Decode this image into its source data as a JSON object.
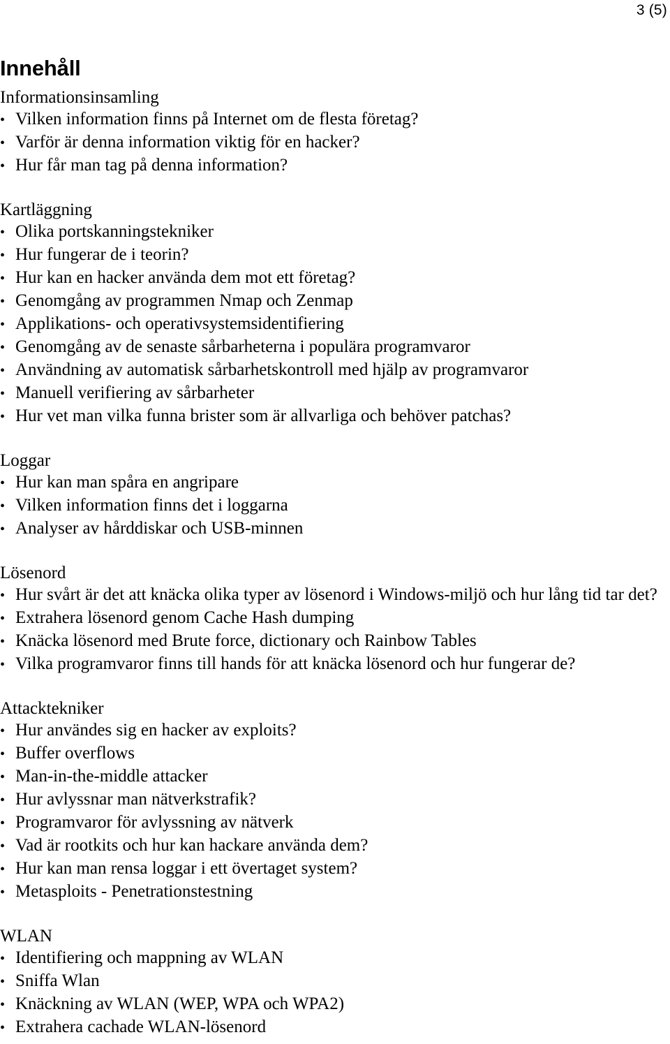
{
  "document": {
    "page_number": "3 (5)",
    "title": "Innehåll",
    "bullet_glyph": "•",
    "text_color": "#000000",
    "background_color": "#ffffff"
  },
  "sections": [
    {
      "heading": "Informationsinsamling",
      "items": [
        "Vilken information finns på Internet om de flesta företag?",
        "Varför är denna information viktig för en hacker?",
        "Hur får man tag på denna information?"
      ]
    },
    {
      "heading": "Kartläggning",
      "items": [
        "Olika portskanningstekniker",
        "Hur fungerar de i teorin?",
        "Hur kan en hacker använda dem mot ett företag?",
        "Genomgång av programmen Nmap och Zenmap",
        "Applikations- och operativsystemsidentifiering",
        "Genomgång av de senaste sårbarheterna i populära programvaror",
        "Användning av automatisk sårbarhetskontroll med hjälp av programvaror",
        "Manuell verifiering av sårbarheter",
        "Hur vet man vilka funna brister som är allvarliga och behöver patchas?"
      ]
    },
    {
      "heading": "Loggar",
      "items": [
        "Hur kan man spåra en angripare",
        "Vilken information finns det i loggarna",
        "Analyser av hårddiskar och USB-minnen"
      ]
    },
    {
      "heading": "Lösenord",
      "items": [
        "Hur svårt är det att knäcka olika typer av lösenord i Windows-miljö och hur lång tid tar det?",
        "Extrahera lösenord genom Cache Hash dumping",
        "Knäcka lösenord med Brute force, dictionary och Rainbow Tables",
        "Vilka programvaror finns till hands för att knäcka lösenord och hur fungerar de?"
      ]
    },
    {
      "heading": "Attacktekniker",
      "items": [
        "Hur användes sig en hacker av exploits?",
        "Buffer overflows",
        "Man-in-the-middle attacker",
        "Hur avlyssnar man nätverkstrafik?",
        "Programvaror för avlyssning av nätverk",
        "Vad är rootkits och hur kan hackare använda dem?",
        "Hur kan man rensa loggar i ett övertaget system?",
        "Metasploits - Penetrationstestning"
      ]
    },
    {
      "heading": "WLAN",
      "items": [
        "Identifiering och mappning av WLAN",
        "Sniffa Wlan",
        "Knäckning av WLAN (WEP, WPA och WPA2)",
        "Extrahera cachade WLAN-lösenord"
      ]
    }
  ]
}
